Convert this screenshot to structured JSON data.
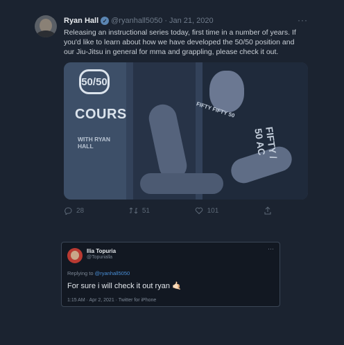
{
  "tweet": {
    "author_name": "Ryan Hall",
    "handle": "@ryanhall5050",
    "separator": "·",
    "date": "Jan 21, 2020",
    "more": "···",
    "text": "Releasing an instructional series today, first time in a number of years. If you'd like to learn about how we have developed the 50/50 position and our Jiu-Jitsu in general for mma and grappling, please check it out.",
    "media": {
      "logo": "50/50",
      "title": "COURSE",
      "subtitle": "WITH RYAN HALL",
      "shirt_text_1": "FIFTY FIFTY 50",
      "shirt_text_2": "FIFTY / 50 AC"
    },
    "actions": {
      "reply_count": "28",
      "retweet_count": "51",
      "like_count": "101"
    }
  },
  "reply": {
    "author_name": "Ilia Topuria",
    "handle": "@Topurialla",
    "more": "···",
    "replying_label": "Replying to",
    "replying_to": "@ryanhall5050",
    "text": "For sure i will check it out ryan 🤙🏻",
    "timestamp": "1:15 AM · Apr 2, 2021 · Twitter for iPhone"
  },
  "colors": {
    "background": "#1b2330",
    "link": "#4a90d9",
    "verified": "#5b86b3"
  }
}
